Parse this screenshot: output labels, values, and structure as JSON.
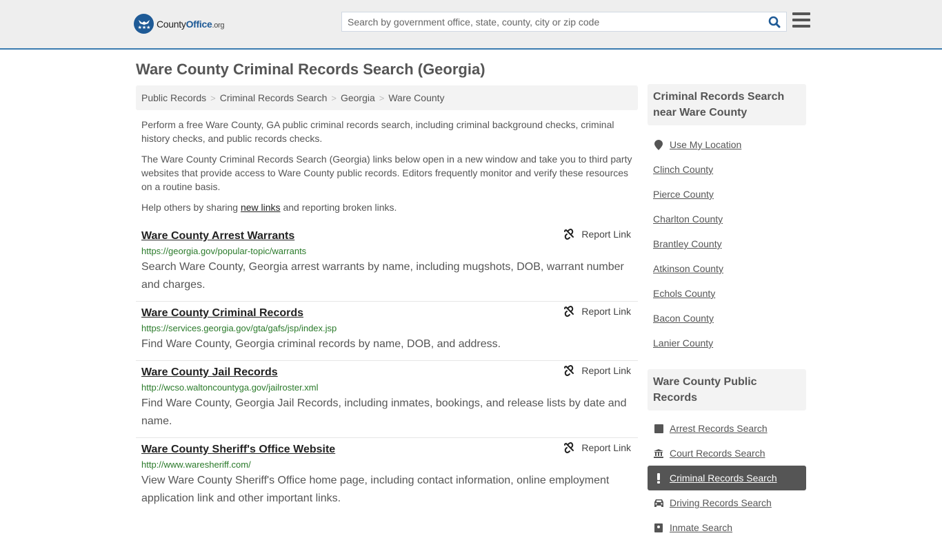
{
  "header": {
    "logo": {
      "county": "County",
      "office": "Office",
      "org": ".org"
    },
    "search_placeholder": "Search by government office, state, county, city or zip code",
    "search_value": ""
  },
  "page_title": "Ware County Criminal Records Search (Georgia)",
  "breadcrumb": [
    "Public Records",
    "Criminal Records Search",
    "Georgia",
    "Ware County"
  ],
  "intro": {
    "p1": "Perform a free Ware County, GA public criminal records search, including criminal background checks, criminal history checks, and public records checks.",
    "p2": "The Ware County Criminal Records Search (Georgia) links below open in a new window and take you to third party websites that provide access to Ware County public records. Editors frequently monitor and verify these resources on a routine basis.",
    "p3_before": "Help others by sharing ",
    "p3_link": "new links",
    "p3_after": " and reporting broken links."
  },
  "report_label": "Report Link",
  "results": [
    {
      "title": "Ware County Arrest Warrants",
      "url": "https://georgia.gov/popular-topic/warrants",
      "desc": "Search Ware County, Georgia arrest warrants by name, including mugshots, DOB, warrant number and charges."
    },
    {
      "title": "Ware County Criminal Records",
      "url": "https://services.georgia.gov/gta/gafs/jsp/index.jsp",
      "desc": "Find Ware County, Georgia criminal records by name, DOB, and address."
    },
    {
      "title": "Ware County Jail Records",
      "url": "http://wcso.waltoncountyga.gov/jailroster.xml",
      "desc": "Find Ware County, Georgia Jail Records, including inmates, bookings, and release lists by date and name."
    },
    {
      "title": "Ware County Sheriff's Office Website",
      "url": "http://www.waresheriff.com/",
      "desc": "View Ware County Sheriff's Office home page, including contact information, online employment application link and other important links."
    }
  ],
  "sidebar": {
    "nearby": {
      "heading": "Criminal Records Search near Ware County",
      "use_location": "Use My Location",
      "counties": [
        "Clinch County",
        "Pierce County",
        "Charlton County",
        "Brantley County",
        "Atkinson County",
        "Echols County",
        "Bacon County",
        "Lanier County"
      ]
    },
    "public_records": {
      "heading": "Ware County Public Records",
      "items": [
        {
          "label": "Arrest Records Search",
          "icon": "square-icon",
          "active": false
        },
        {
          "label": "Court Records Search",
          "icon": "courthouse-icon",
          "active": false
        },
        {
          "label": "Criminal Records Search",
          "icon": "exclamation-icon",
          "active": true
        },
        {
          "label": "Driving Records Search",
          "icon": "car-icon",
          "active": false
        },
        {
          "label": "Inmate Search",
          "icon": "inmate-icon",
          "active": false
        }
      ]
    }
  },
  "colors": {
    "brand_blue": "#1e5a96",
    "header_border": "#3a7bb0",
    "url_green": "#2a7a2a",
    "active_bg": "#555555"
  }
}
